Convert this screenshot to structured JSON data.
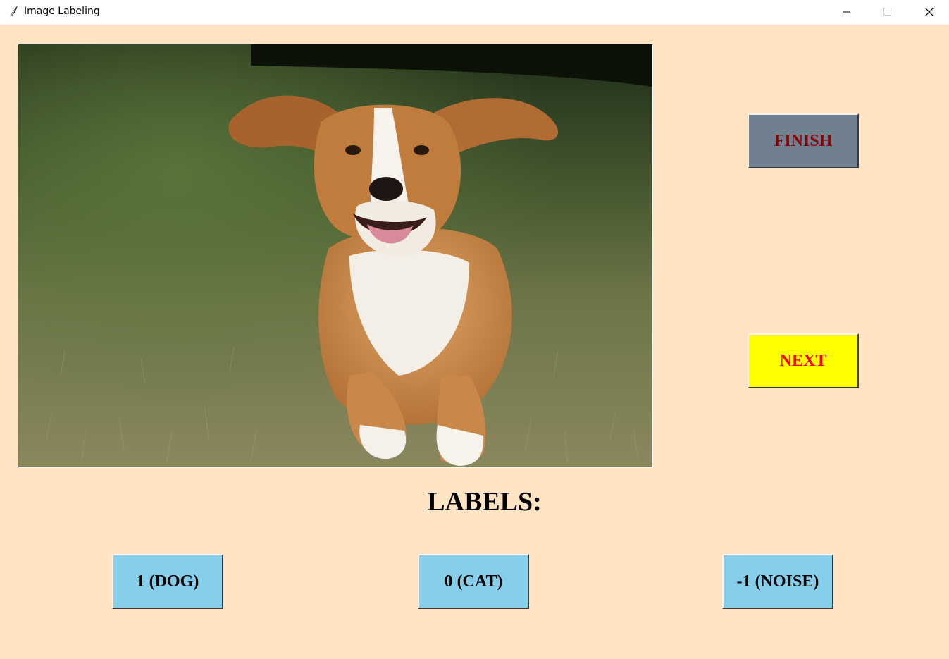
{
  "window": {
    "title": "Image Labeling",
    "background": "#ffe4c4"
  },
  "titlebar_controls": [
    "minimize-icon",
    "maximize-icon",
    "close-icon"
  ],
  "image": {
    "subject": "beagle running on grass"
  },
  "buttons": {
    "finish": {
      "label": "FINISH",
      "bg": "#708090",
      "fg": "#8b0000"
    },
    "next": {
      "label": "NEXT",
      "bg": "#ffff00",
      "fg": "#ff0000"
    }
  },
  "labels_section": {
    "heading": "LABELS:",
    "options": [
      {
        "label": "1 (DOG)",
        "bg": "#87ceeb"
      },
      {
        "label": "0 (CAT)",
        "bg": "#87ceeb"
      },
      {
        "label": "-1 (NOISE)",
        "bg": "#87ceeb"
      }
    ]
  }
}
